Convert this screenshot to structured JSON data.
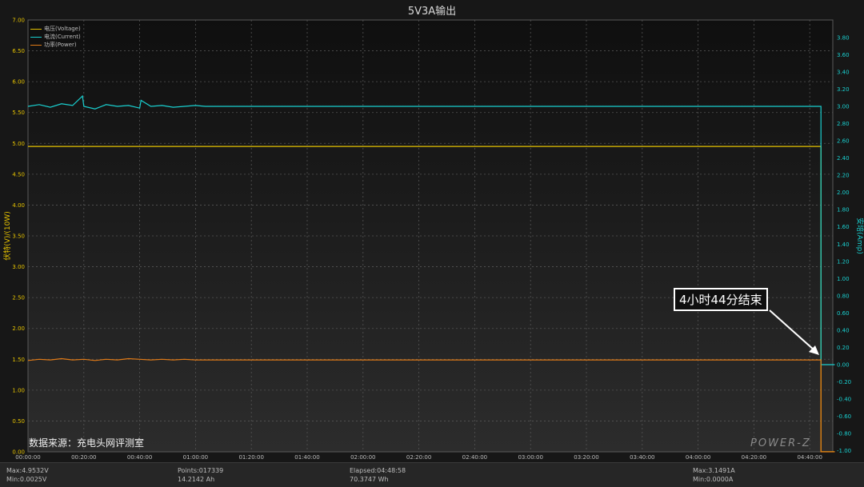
{
  "title": "5V3A输出",
  "source_text": "数据来源：充电头网评测室",
  "watermark": "POWER-Z",
  "annotation": "4小时44分结束",
  "colors": {
    "voltage": "#e6c300",
    "current": "#19d0d0",
    "power": "#e07a17",
    "grid": "#555555",
    "background_top": "#0f0f0f",
    "background_bottom": "#2c2c2c"
  },
  "footer": {
    "max_voltage": "Max:4.9532V",
    "min_voltage": "Min:0.0025V",
    "points": "Points:017339",
    "capacity": "14.2142 Ah",
    "elapsed": "Elapsed:04:48:58",
    "energy": "70.3747 Wh",
    "max_current": "Max:3.1491A",
    "min_current": "Min:0.0000A"
  },
  "chart_data": {
    "type": "line",
    "title": "5V3A输出",
    "ylabel_left": "伏特(V)/(10W)",
    "ylabel_right": "安培(Amp)",
    "x_tick_labels": [
      "00:00:00",
      "00:20:00",
      "00:40:00",
      "01:00:00",
      "01:20:00",
      "01:40:00",
      "02:00:00",
      "02:20:00",
      "02:40:00",
      "03:00:00",
      "03:20:00",
      "03:40:00",
      "04:00:00",
      "04:20:00",
      "04:40:00"
    ],
    "x_range_minutes": [
      0,
      288.97
    ],
    "ylim_left": [
      0,
      7
    ],
    "y_left_ticks": [
      "0.00",
      "0.50",
      "1.00",
      "1.50",
      "2.00",
      "2.50",
      "3.00",
      "3.50",
      "4.00",
      "4.50",
      "5.00",
      "5.50",
      "6.00",
      "6.50",
      "7.00"
    ],
    "ylim_right": [
      -1,
      3.9
    ],
    "y_right_ticks": [
      "-1.00",
      "-0.80",
      "-0.60",
      "-0.40",
      "-0.20",
      "0.00",
      "0.20",
      "0.40",
      "0.60",
      "0.80",
      "1.00",
      "1.20",
      "1.40",
      "1.60",
      "1.80",
      "2.00",
      "2.20",
      "2.40",
      "2.60",
      "2.80",
      "3.00",
      "3.20",
      "3.40",
      "3.60",
      "3.80"
    ],
    "grid": true,
    "legend_position": "top-left",
    "series": [
      {
        "name": "电压(Voltage)",
        "axis": "left",
        "x_minutes": [
          0,
          284,
          284,
          288.97
        ],
        "values": [
          4.95,
          4.95,
          0.0025,
          0.0025
        ]
      },
      {
        "name": "电流(Current)",
        "axis": "right",
        "x_minutes": [
          0,
          4,
          8,
          12,
          16,
          19.5,
          20,
          24,
          28,
          32,
          36,
          40,
          40.5,
          44,
          48,
          52,
          56,
          60,
          63.5,
          284,
          284,
          288.97
        ],
        "values": [
          3.0,
          3.02,
          2.99,
          3.03,
          3.01,
          3.12,
          3.0,
          2.97,
          3.02,
          3.0,
          3.01,
          2.98,
          3.07,
          3.0,
          3.01,
          2.99,
          3.0,
          3.01,
          3.0,
          3.0,
          0.0,
          0.0
        ]
      },
      {
        "name": "功率(Power)",
        "axis": "left",
        "x_minutes": [
          0,
          4,
          8,
          12,
          16,
          20,
          24,
          28,
          32,
          36,
          40,
          44,
          48,
          52,
          56,
          60,
          63.5,
          284,
          284,
          288.97
        ],
        "values": [
          1.48,
          1.5,
          1.49,
          1.51,
          1.49,
          1.5,
          1.48,
          1.5,
          1.49,
          1.51,
          1.5,
          1.49,
          1.5,
          1.49,
          1.5,
          1.49,
          1.49,
          1.49,
          0.0,
          0.0
        ]
      }
    ]
  }
}
